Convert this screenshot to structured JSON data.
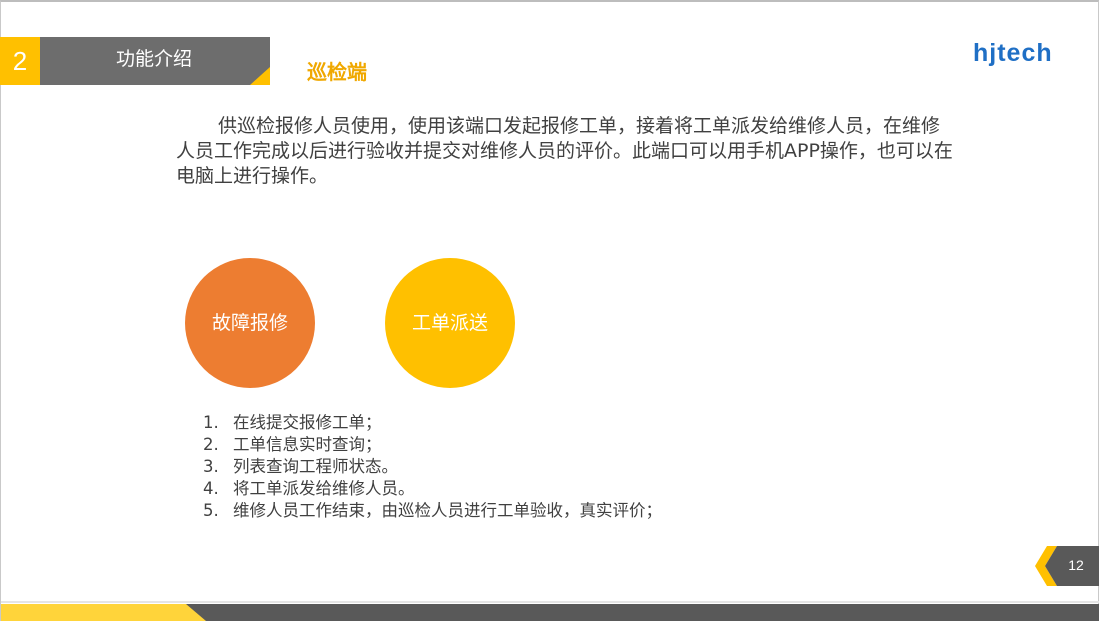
{
  "section": {
    "number": "2",
    "title": "功能介绍"
  },
  "heading": "巡检端",
  "logo": {
    "text": "hjtech",
    "color": "#1f6fc5"
  },
  "intro": "供巡检报修人员使用，使用该端口发起报修工单，接着将工单派发给维修人员，在维修人员工作完成以后进行验收并提交对维修人员的评价。此端口可以用手机APP操作，也可以在电脑上进行操作。",
  "circles": [
    {
      "label": "故障报修",
      "color": "#ed7d31"
    },
    {
      "label": "工单派送",
      "color": "#ffc000"
    }
  ],
  "features": [
    {
      "num": "1.",
      "text": "在线提交报修工单；"
    },
    {
      "num": "2.",
      "text": "工单信息实时查询；"
    },
    {
      "num": "3.",
      "text": "列表查询工程师状态。"
    },
    {
      "num": "4.",
      "text": "将工单派发给维修人员。"
    },
    {
      "num": "5.",
      "text": "维修人员工作结束，由巡检人员进行工单验收，真实评价；"
    }
  ],
  "page_number": "12",
  "colors": {
    "accent": "#ffc000",
    "orange": "#ed7d31",
    "gray": "#6d6d6d"
  }
}
